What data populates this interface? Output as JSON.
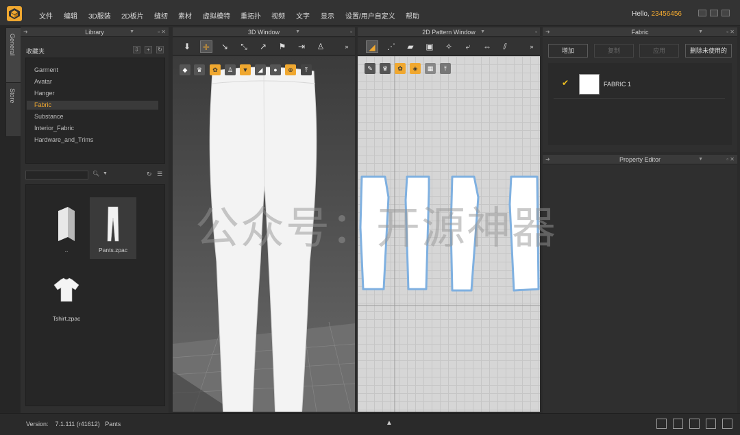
{
  "menu": {
    "items": [
      "文件",
      "编辑",
      "3D服装",
      "2D板片",
      "缝纫",
      "素材",
      "虚拟模特",
      "重拓扑",
      "视频",
      "文字",
      "显示",
      "设置/用户自定义",
      "帮助"
    ],
    "greeting": "Hello,",
    "username": "23456456"
  },
  "side_tabs": {
    "general": "General",
    "store": "Store"
  },
  "library": {
    "title": "Library",
    "favorites_label": "收藏夹",
    "tree": [
      "Garment",
      "Avatar",
      "Hanger",
      "Fabric",
      "Substance",
      "Interior_Fabric",
      "Hardware_and_Trims"
    ],
    "selected": "Fabric",
    "files": [
      "..",
      "Pants.zpac",
      "Tshirt.zpac"
    ]
  },
  "window_3d": {
    "title": "3D Window"
  },
  "window_2d": {
    "title": "2D Pattern Window"
  },
  "fabric": {
    "title": "Fabric",
    "buttons": [
      "增加",
      "复制",
      "应用",
      "删除未使用的"
    ],
    "items": [
      {
        "name": "FABRIC 1",
        "checked": true,
        "color": "#ffffff"
      }
    ]
  },
  "property_editor": {
    "title": "Property Editor"
  },
  "status": {
    "version_label": "Version:",
    "version": "7.1.111 (r41612)",
    "file": "Pants"
  },
  "watermark": "公众号：开源神器",
  "colors": {
    "accent": "#f0a830",
    "pattern_outline": "#7fb0e0"
  }
}
